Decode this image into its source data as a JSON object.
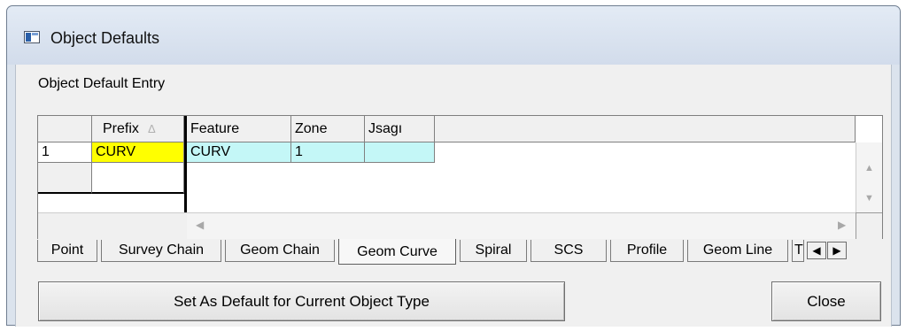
{
  "window": {
    "title": "Object Defaults"
  },
  "entry_label": "Object Default Entry",
  "grid": {
    "headers": {
      "prefix": "Prefix",
      "sort_glyph": "∆",
      "feature": "Feature",
      "zone": "Zone",
      "usage": "Jsagı"
    },
    "rows": [
      {
        "num": "1",
        "prefix": "CURV",
        "feature": "CURV",
        "zone": "1",
        "usage": ""
      }
    ],
    "colors": {
      "prefix_cell": "#ffff00",
      "row_cells": "#c4f7f7"
    }
  },
  "tabs": [
    {
      "label": "Point"
    },
    {
      "label": "Survey Chain"
    },
    {
      "label": "Geom Chain"
    },
    {
      "label": "Geom Curve",
      "active": true
    },
    {
      "label": "Spiral"
    },
    {
      "label": "SCS"
    },
    {
      "label": "Profile"
    },
    {
      "label": "Geom Line"
    },
    {
      "label": "T"
    }
  ],
  "buttons": {
    "set_default": "Set As Default for Current Object Type",
    "close": "Close"
  }
}
